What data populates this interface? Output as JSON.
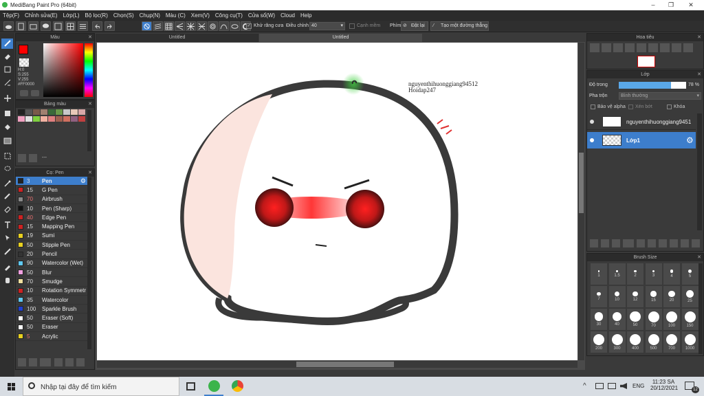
{
  "app": {
    "title": "MediBang Paint Pro (64bit)"
  },
  "menu": [
    "Tệp(F)",
    "Chỉnh sửa(E)",
    "Lớp(L)",
    "Bộ lọc(R)",
    "Chọn(S)",
    "Chụp(N)",
    "Màu (C)",
    "Xem(V)",
    "Công cụ(T)",
    "Cửa sổ(W)",
    "Cloud",
    "Help"
  ],
  "toolbar": {
    "antialias_label": "Khử răng cưa",
    "correction_label": "Điều chỉnh",
    "correction_value": "40",
    "soft_edge_label": "Cạnh mềm",
    "key_label": "Phím",
    "reset_label": "Đặt lại",
    "create_line_label": "Tạo một đường thẳng"
  },
  "tabs": [
    "Untitled",
    "Untitled"
  ],
  "color_panel": {
    "title": "Màu",
    "h": "H:0",
    "s": "S:255",
    "v": "V:255",
    "hex": "#FF0000",
    "primary": "#ff0000"
  },
  "palette_panel": {
    "title": "Bảng màu",
    "dash": "---",
    "colors": [
      "#222222",
      "#555555",
      "#7a5a4a",
      "#a08070",
      "#3a6a3a",
      "#6a9a4a",
      "#c8c8c8",
      "#e8c8b8",
      "#d8a8a8",
      "#f0a0c0",
      "#e0e0e0",
      "#80d040",
      "#f0b0a0",
      "#e08080",
      "#a06050",
      "#d07060",
      "#906080",
      "#c04040"
    ]
  },
  "brush_panel": {
    "title": "Cọ: Pen",
    "items": [
      {
        "size": "3",
        "name": "Pen",
        "color": "#222222",
        "sel": true
      },
      {
        "size": "15",
        "name": "G Pen",
        "color": "#cc2222"
      },
      {
        "size": "70",
        "name": "Airbrush",
        "color": "#888888",
        "dim": true
      },
      {
        "size": "10",
        "name": "Pen (Sharp)",
        "color": "#111111"
      },
      {
        "size": "40",
        "name": "Edge Pen",
        "color": "#cc2222",
        "dim": true
      },
      {
        "size": "15",
        "name": "Mapping Pen",
        "color": "#cc2222"
      },
      {
        "size": "19",
        "name": "Sumi",
        "color": "#e8d020"
      },
      {
        "size": "50",
        "name": "Stipple Pen",
        "color": "#e8d020"
      },
      {
        "size": "20",
        "name": "Pencil",
        "color": "#333333"
      },
      {
        "size": "90",
        "name": "Watercolor (Wet)",
        "color": "#60c8f0"
      },
      {
        "size": "50",
        "name": "Blur",
        "color": "#f0a0e0"
      },
      {
        "size": "70",
        "name": "Smudge",
        "color": "#f0e0a0"
      },
      {
        "size": "10",
        "name": "Rotation Symmetr",
        "color": "#cc2222"
      },
      {
        "size": "35",
        "name": "Watercolor",
        "color": "#60c8f0"
      },
      {
        "size": "100",
        "name": "Sparkle Brush",
        "color": "#2040d0"
      },
      {
        "size": "50",
        "name": "Eraser (Soft)",
        "color": "#ffffff"
      },
      {
        "size": "50",
        "name": "Eraser",
        "color": "#ffffff"
      },
      {
        "size": "5",
        "name": "Acrylic",
        "color": "#e8d020",
        "dim": true
      }
    ]
  },
  "navigator": {
    "title": "Hoa tiêu"
  },
  "layer_panel": {
    "title": "Lớp",
    "opacity_label": "Độ trong",
    "opacity_value": "78 %",
    "opacity_fraction": 0.78,
    "blend_label": "Pha trộn",
    "blend_value": "Bình thường",
    "protect_alpha": "Bảo vệ alpha",
    "clip": "Xén bớt",
    "lock": "Khóa",
    "layers": [
      {
        "name": "nguyenthihuonggiang9451"
      },
      {
        "name": "Lớp1",
        "sel": true
      }
    ]
  },
  "brush_size": {
    "title": "Brush Size",
    "sizes": [
      "1",
      "1.5",
      "2",
      "3",
      "4",
      "5",
      "7",
      "10",
      "12",
      "15",
      "20",
      "25",
      "30",
      "40",
      "50",
      "70",
      "100",
      "150",
      "200",
      "300",
      "400",
      "500",
      "700",
      "1000"
    ]
  },
  "canvas": {
    "text_line1": "nguyenthihuonggiang94512",
    "text_line2": "Hoidap247"
  },
  "taskbar": {
    "search": "Nhập tại đây để tìm kiếm",
    "lang": "ENG",
    "time": "11:23 SA",
    "date": "20/12/2021",
    "badge": "12"
  }
}
